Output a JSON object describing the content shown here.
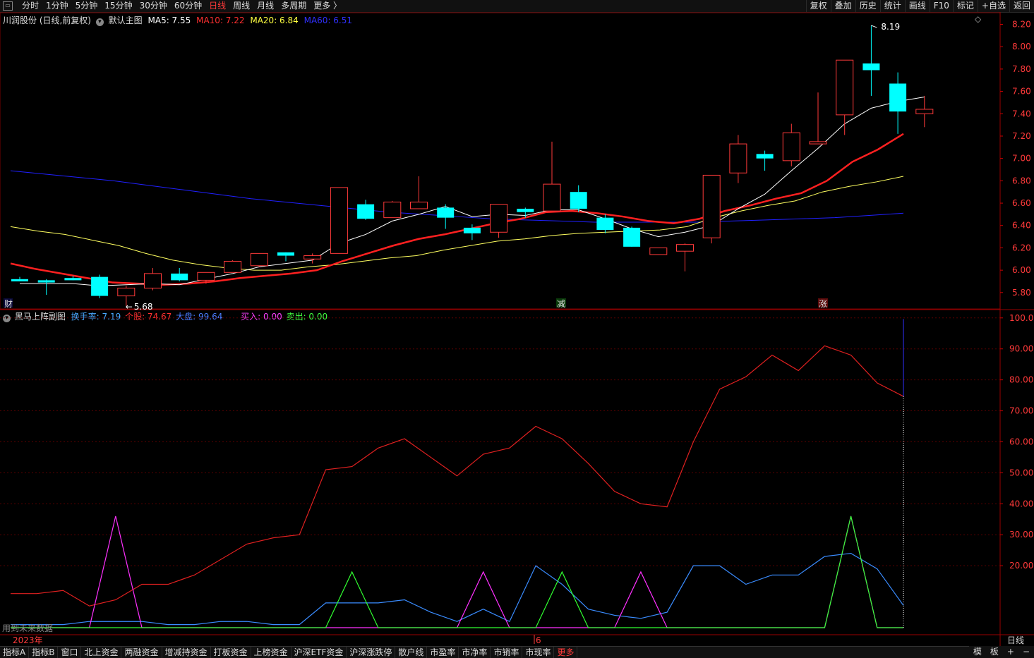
{
  "toolbar": {
    "tabs": [
      "分时",
      "1分钟",
      "5分钟",
      "15分钟",
      "30分钟",
      "60分钟",
      "日线",
      "周线",
      "月线",
      "多周期",
      "更多 〉"
    ],
    "active_tab": "日线",
    "right_items": [
      "复权",
      "叠加",
      "历史",
      "统计",
      "画线",
      "F10",
      "标记",
      "+自选",
      "返回"
    ]
  },
  "main_chart": {
    "stock_label": "川润股份 (日线,前复权)",
    "indicator_name": "默认主图",
    "ma5": "MA5: 7.55",
    "ma10": "MA10: 7.22",
    "ma20": "MA20: 6.84",
    "ma60": "MA60: 6.51",
    "y_ticks": [
      "8.20",
      "8.00",
      "7.80",
      "7.60",
      "7.40",
      "7.20",
      "7.00",
      "6.80",
      "6.60",
      "6.40",
      "6.20",
      "6.00",
      "5.80"
    ],
    "high_label": "8.19",
    "low_label": "5.68",
    "marker_cai": "财",
    "marker_jian": "减",
    "marker_zhang": "涨"
  },
  "sub_chart": {
    "name": "黑马上阵副图",
    "turnover": "换手率: 7.19",
    "stock": "个股: 74.67",
    "market": "大盘: 99.64",
    "buy": "买入: 0.00",
    "sell": "卖出: 0.00",
    "y_ticks": [
      "100.0",
      "90.00",
      "80.00",
      "70.00",
      "60.00",
      "50.00",
      "40.00",
      "30.00",
      "20.00"
    ],
    "footer_note": "用到未来数据",
    "year_label": "2023年",
    "month_label": "6",
    "period_label": "日线"
  },
  "bottom_tabs": [
    "指标A",
    "指标B",
    "窗口",
    "北上资金",
    "两融资金",
    "增减持资金",
    "打板资金",
    "上榜资金",
    "沪深ETF资金",
    "沪深涨跌停",
    "散户线",
    "市盈率",
    "市净率",
    "市销率",
    "市现率",
    "更多"
  ],
  "bottom_active": "更多",
  "bottom_right": [
    "模",
    "板",
    "+",
    "−"
  ],
  "colors": {
    "up": "#ff3a3a",
    "down": "#00ffff",
    "ma5": "#ffffff",
    "ma10": "#ff2020",
    "ma20": "#ffff60",
    "ma60": "#2020ff"
  },
  "chart_data": {
    "type": "candlestick",
    "candles": [
      {
        "o": 5.92,
        "h": 5.94,
        "l": 5.9,
        "c": 5.9
      },
      {
        "o": 5.91,
        "h": 5.92,
        "l": 5.78,
        "c": 5.89
      },
      {
        "o": 5.93,
        "h": 5.95,
        "l": 5.91,
        "c": 5.91
      },
      {
        "o": 5.94,
        "h": 5.96,
        "l": 5.75,
        "c": 5.77
      },
      {
        "o": 5.77,
        "h": 5.86,
        "l": 5.68,
        "c": 5.84
      },
      {
        "o": 5.84,
        "h": 6.02,
        "l": 5.82,
        "c": 5.97
      },
      {
        "o": 5.97,
        "h": 6.02,
        "l": 5.9,
        "c": 5.91
      },
      {
        "o": 5.91,
        "h": 5.98,
        "l": 5.88,
        "c": 5.98
      },
      {
        "o": 5.98,
        "h": 6.09,
        "l": 5.98,
        "c": 6.08
      },
      {
        "o": 6.04,
        "h": 6.15,
        "l": 6.03,
        "c": 6.15
      },
      {
        "o": 6.16,
        "h": 6.16,
        "l": 6.08,
        "c": 6.13
      },
      {
        "o": 6.1,
        "h": 6.15,
        "l": 6.06,
        "c": 6.13
      },
      {
        "o": 6.15,
        "h": 6.74,
        "l": 6.15,
        "c": 6.74
      },
      {
        "o": 6.59,
        "h": 6.63,
        "l": 6.45,
        "c": 6.46
      },
      {
        "o": 6.47,
        "h": 6.62,
        "l": 6.47,
        "c": 6.61
      },
      {
        "o": 6.55,
        "h": 6.84,
        "l": 6.55,
        "c": 6.61
      },
      {
        "o": 6.56,
        "h": 6.59,
        "l": 6.37,
        "c": 6.47
      },
      {
        "o": 6.38,
        "h": 6.41,
        "l": 6.27,
        "c": 6.33
      },
      {
        "o": 6.34,
        "h": 6.59,
        "l": 6.29,
        "c": 6.59
      },
      {
        "o": 6.55,
        "h": 6.56,
        "l": 6.47,
        "c": 6.52
      },
      {
        "o": 6.53,
        "h": 7.15,
        "l": 6.53,
        "c": 6.77
      },
      {
        "o": 6.7,
        "h": 6.76,
        "l": 6.52,
        "c": 6.55
      },
      {
        "o": 6.47,
        "h": 6.5,
        "l": 6.33,
        "c": 6.36
      },
      {
        "o": 6.38,
        "h": 6.39,
        "l": 6.21,
        "c": 6.21
      },
      {
        "o": 6.14,
        "h": 6.2,
        "l": 6.14,
        "c": 6.2
      },
      {
        "o": 6.17,
        "h": 6.24,
        "l": 5.99,
        "c": 6.23
      },
      {
        "o": 6.29,
        "h": 6.85,
        "l": 6.24,
        "c": 6.85
      },
      {
        "o": 6.87,
        "h": 7.21,
        "l": 6.78,
        "c": 7.13
      },
      {
        "o": 7.04,
        "h": 7.07,
        "l": 6.89,
        "c": 7.0
      },
      {
        "o": 6.98,
        "h": 7.31,
        "l": 6.93,
        "c": 7.23
      },
      {
        "o": 7.13,
        "h": 7.59,
        "l": 7.13,
        "c": 7.15
      },
      {
        "o": 7.39,
        "h": 7.88,
        "l": 7.21,
        "c": 7.88
      },
      {
        "o": 7.85,
        "h": 8.19,
        "l": 7.56,
        "c": 7.79
      },
      {
        "o": 7.67,
        "h": 7.77,
        "l": 7.22,
        "c": 7.42
      },
      {
        "o": 7.4,
        "h": 7.56,
        "l": 7.28,
        "c": 7.44
      }
    ],
    "ma5": [
      5.88,
      5.88,
      5.88,
      5.86,
      5.87,
      5.88,
      5.87,
      5.92,
      5.97,
      6.03,
      6.06,
      6.09,
      6.24,
      6.32,
      6.44,
      6.5,
      6.57,
      6.48,
      6.5,
      6.49,
      6.54,
      6.54,
      6.46,
      6.37,
      6.3,
      6.34,
      6.4,
      6.55,
      6.68,
      6.89,
      7.09,
      7.31,
      7.45,
      7.51,
      7.55
    ],
    "ma10": [
      6.06,
      6.01,
      5.97,
      5.93,
      5.89,
      5.88,
      5.87,
      5.88,
      5.9,
      5.93,
      5.95,
      5.97,
      6.0,
      6.08,
      6.15,
      6.22,
      6.28,
      6.32,
      6.37,
      6.42,
      6.46,
      6.52,
      6.53,
      6.51,
      6.48,
      6.44,
      6.42,
      6.46,
      6.53,
      6.58,
      6.64,
      6.69,
      6.8,
      6.97,
      7.08,
      7.22
    ],
    "ma20": [
      6.39,
      6.35,
      6.32,
      6.27,
      6.22,
      6.15,
      6.09,
      6.05,
      6.02,
      6.0,
      6.0,
      6.03,
      6.05,
      6.08,
      6.11,
      6.13,
      6.18,
      6.22,
      6.26,
      6.28,
      6.31,
      6.33,
      6.34,
      6.35,
      6.36,
      6.39,
      6.47,
      6.53,
      6.58,
      6.62,
      6.7,
      6.75,
      6.79,
      6.84
    ],
    "ma60": [
      6.89,
      6.86,
      6.83,
      6.8,
      6.76,
      6.72,
      6.68,
      6.64,
      6.61,
      6.58,
      6.55,
      6.52,
      6.5,
      6.48,
      6.46,
      6.45,
      6.44,
      6.43,
      6.43,
      6.43,
      6.43,
      6.44,
      6.45,
      6.46,
      6.47,
      6.49,
      6.51
    ],
    "ylim_main": [
      5.66,
      8.26
    ],
    "sub_ylim": [
      0,
      102
    ],
    "stock_line": [
      11,
      11,
      12,
      7,
      9,
      14,
      14,
      17,
      22,
      27,
      29,
      30,
      51,
      52,
      58,
      61,
      55,
      49,
      56,
      58,
      65,
      61,
      53,
      44,
      40,
      39,
      60,
      77,
      81,
      88,
      83,
      91,
      88,
      79,
      74.67
    ],
    "market_line": [
      1,
      1,
      1,
      2,
      2,
      2,
      1,
      1,
      2,
      2,
      1,
      1,
      8,
      8,
      8,
      9,
      5,
      2,
      6,
      2,
      20,
      14,
      6,
      4,
      3,
      5,
      20,
      20,
      14,
      17,
      17,
      23,
      24,
      19,
      7.19
    ],
    "buy_line": [
      0,
      0,
      0,
      0,
      36,
      0,
      0,
      0,
      0,
      0,
      0,
      0,
      0,
      0,
      0,
      0,
      0,
      0,
      18,
      0,
      0,
      0,
      0,
      0,
      18,
      0,
      0,
      0,
      0,
      0,
      0,
      0,
      36,
      0,
      0
    ],
    "sell_line": [
      0,
      0,
      0,
      0,
      0,
      0,
      0,
      0,
      0,
      0,
      0,
      0,
      0,
      18,
      0,
      0,
      0,
      0,
      0,
      0,
      0,
      18,
      0,
      0,
      0,
      0,
      0,
      0,
      0,
      0,
      0,
      0,
      36,
      0,
      0
    ],
    "final_spike": 99.64
  }
}
